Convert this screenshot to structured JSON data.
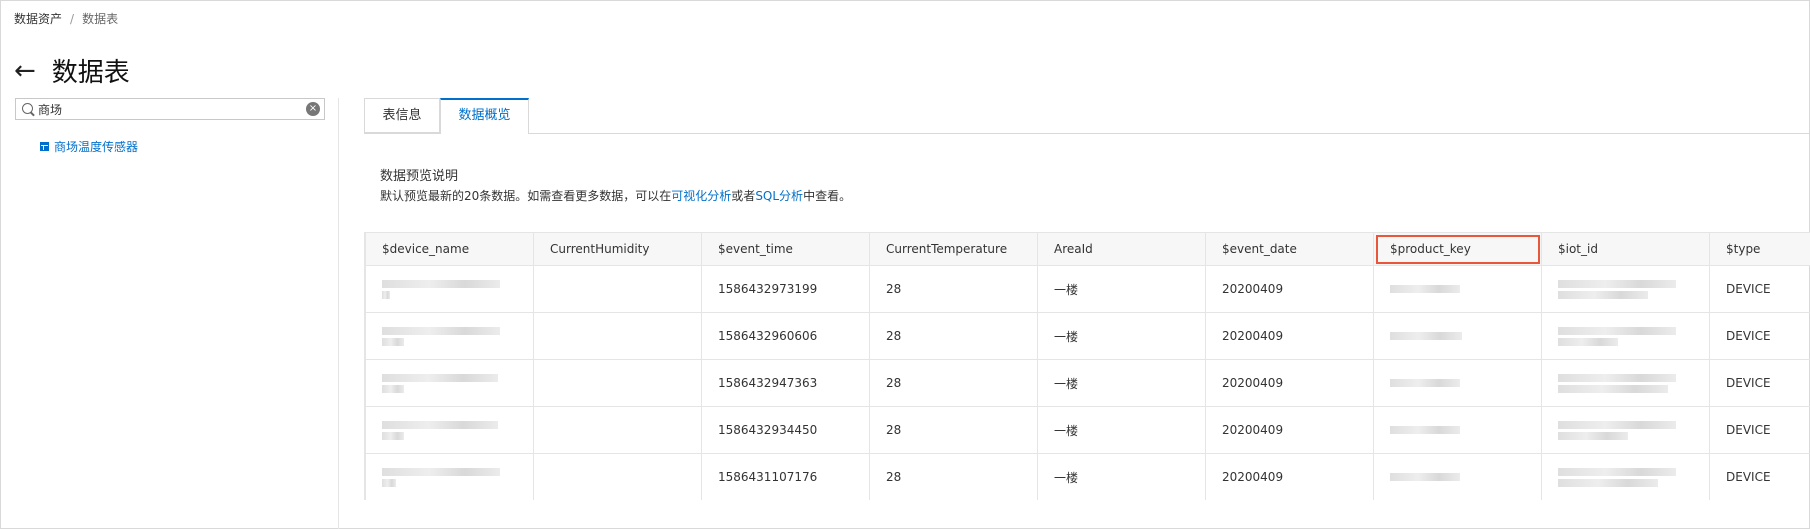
{
  "breadcrumb": {
    "root": "数据资产",
    "separator": "/",
    "current": "数据表"
  },
  "page": {
    "back_icon": "arrow-left-icon",
    "title": "数据表"
  },
  "search": {
    "value": "商场",
    "search_icon": "search-icon",
    "clear_icon": "clear-circle-icon"
  },
  "tree": {
    "items": [
      {
        "label": "商场温度传感器",
        "icon": "table-icon"
      }
    ]
  },
  "tabs": [
    {
      "label": "表信息",
      "active": false
    },
    {
      "label": "数据概览",
      "active": true
    }
  ],
  "preview": {
    "title": "数据预览说明",
    "text_before": "默认预览最新的20条数据。如需查看更多数据，可以在",
    "link1": "可视化分析",
    "text_mid": "或者",
    "link2": "SQL分析",
    "text_after": "中查看。"
  },
  "table": {
    "highlight_color": "#e8573a",
    "columns": [
      "$device_name",
      "CurrentHumidity",
      "$event_time",
      "CurrentTemperature",
      "AreaId",
      "$event_date",
      "$product_key",
      "$iot_id",
      "$type"
    ],
    "highlight_column": "$product_key",
    "rows": [
      {
        "event_time": "1586432973199",
        "temperature": "28",
        "area": "一楼",
        "event_date": "20200409",
        "type": "DEVICE"
      },
      {
        "event_time": "1586432960606",
        "temperature": "28",
        "area": "一楼",
        "event_date": "20200409",
        "type": "DEVICE"
      },
      {
        "event_time": "1586432947363",
        "temperature": "28",
        "area": "一楼",
        "event_date": "20200409",
        "type": "DEVICE"
      },
      {
        "event_time": "1586432934450",
        "temperature": "28",
        "area": "一楼",
        "event_date": "20200409",
        "type": "DEVICE"
      },
      {
        "event_time": "1586431107176",
        "temperature": "28",
        "area": "一楼",
        "event_date": "20200409",
        "type": "DEVICE"
      }
    ]
  }
}
